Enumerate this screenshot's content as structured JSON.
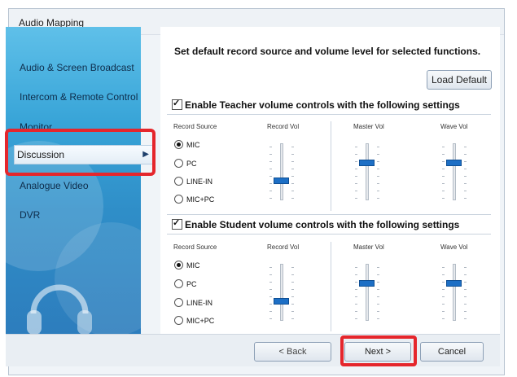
{
  "window": {
    "title": "Audio Mapping"
  },
  "sidebar": {
    "items": [
      {
        "label": "Audio & Screen Broadcast"
      },
      {
        "label": "Intercom & Remote Control"
      },
      {
        "label": "Monitor"
      },
      {
        "label": "Discussion",
        "active": true
      },
      {
        "label": "Analogue Video"
      },
      {
        "label": "DVR"
      }
    ]
  },
  "main": {
    "headline": "Set default record source and volume level for selected functions.",
    "load_default": "Load Default",
    "columns": {
      "record_source": "Record Source",
      "record_vol": "Record Vol",
      "master_vol": "Master Vol",
      "wave_vol": "Wave Vol"
    },
    "teacher": {
      "title": "Enable Teacher volume controls with the following settings",
      "enabled": true,
      "sources": [
        "MIC",
        "PC",
        "LINE-IN",
        "MIC+PC"
      ],
      "selected": "MIC",
      "record_vol": 0.33,
      "master_vol": 0.68,
      "wave_vol": 0.68
    },
    "student": {
      "title": "Enable Student volume controls with the following settings",
      "enabled": true,
      "sources": [
        "MIC",
        "PC",
        "LINE-IN",
        "MIC+PC"
      ],
      "selected": "MIC",
      "record_vol": 0.33,
      "master_vol": 0.68,
      "wave_vol": 0.68
    }
  },
  "footer": {
    "back": "< Back",
    "next": "Next >",
    "cancel": "Cancel"
  },
  "colors": {
    "accent": "#1d6fc5",
    "highlight": "#e5262c",
    "sidebar": "#3aa6d9"
  }
}
